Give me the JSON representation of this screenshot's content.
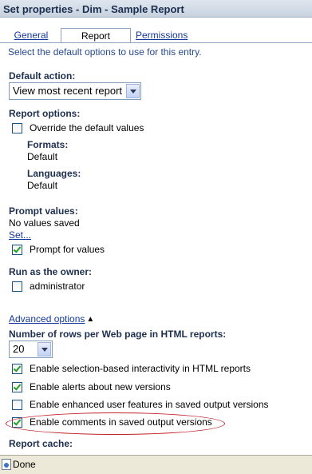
{
  "window": {
    "title": "Set properties - Dim - Sample Report"
  },
  "tabs": [
    {
      "label": "General",
      "active": false
    },
    {
      "label": "Report",
      "active": true
    },
    {
      "label": "Permissions",
      "active": false
    }
  ],
  "intro": "Select the default options to use for this entry.",
  "default_action": {
    "label": "Default action:",
    "value": "View most recent report"
  },
  "report_options": {
    "label": "Report options:",
    "override": {
      "label": "Override the default values",
      "checked": false
    },
    "formats_label": "Formats:",
    "formats_value": "Default",
    "languages_label": "Languages:",
    "languages_value": "Default"
  },
  "prompt_values": {
    "label": "Prompt values:",
    "status": "No values saved",
    "set_link": "Set...",
    "prompt_for_values": {
      "label": "Prompt for values",
      "checked": true
    }
  },
  "run_as_owner": {
    "label": "Run as the owner:",
    "administrator": {
      "label": "administrator",
      "checked": false
    }
  },
  "advanced": {
    "link": "Advanced options",
    "rows_label": "Number of rows per Web page in HTML reports:",
    "rows_value": "20",
    "options": [
      {
        "label": "Enable selection-based interactivity in HTML reports",
        "checked": true
      },
      {
        "label": "Enable alerts about new versions",
        "checked": true
      },
      {
        "label": "Enable enhanced user features in saved output versions",
        "checked": false
      },
      {
        "label": "Enable comments in saved output versions",
        "checked": true
      }
    ],
    "report_cache_label": "Report cache:"
  },
  "status_bar": {
    "text": "Done"
  },
  "colors": {
    "highlight_ellipse": "#c2222a",
    "link": "#13389b",
    "label": "#1d2f4f"
  }
}
